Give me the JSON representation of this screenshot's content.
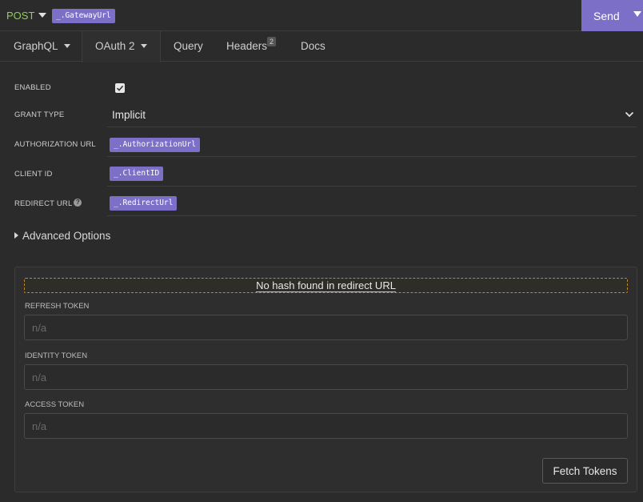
{
  "urlbar": {
    "method": "POST",
    "url_tag": "_.GatewayUrl",
    "send_label": "Send"
  },
  "tabs": [
    {
      "label": "GraphQL",
      "dropdown": true
    },
    {
      "label": "OAuth 2",
      "dropdown": true,
      "active": true
    },
    {
      "label": "Query"
    },
    {
      "label": "Headers",
      "badge": "2"
    },
    {
      "label": "Docs"
    }
  ],
  "oauth": {
    "enabled_label": "ENABLED",
    "enabled_checked": true,
    "grant_type_label": "GRANT TYPE",
    "grant_type_value": "Implicit",
    "authorization_url_label": "AUTHORIZATION URL",
    "authorization_url_tag": "_.AuthorizationUrl",
    "client_id_label": "CLIENT ID",
    "client_id_tag": "_.ClientID",
    "redirect_url_label": "REDIRECT URL",
    "redirect_url_tag": "_.RedirectUrl",
    "advanced_label": "Advanced Options"
  },
  "tokens": {
    "warning": "No hash found in redirect URL",
    "refresh_label": "REFRESH TOKEN",
    "refresh_placeholder": "n/a",
    "identity_label": "IDENTITY TOKEN",
    "identity_placeholder": "n/a",
    "access_label": "ACCESS TOKEN",
    "access_placeholder": "n/a",
    "fetch_label": "Fetch Tokens"
  },
  "colors": {
    "accent": "#7c6fc7",
    "method": "#8fd14f",
    "warning_border": "#c8861e"
  }
}
